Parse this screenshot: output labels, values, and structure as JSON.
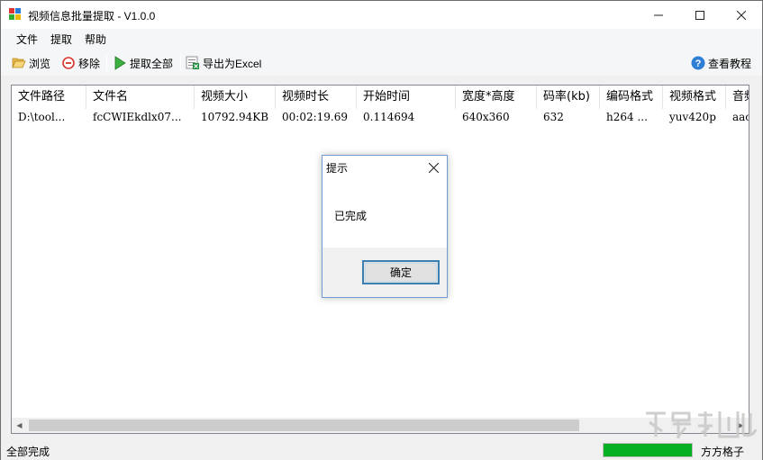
{
  "window": {
    "title": "视频信息批量提取 - V1.0.0"
  },
  "menu": [
    "文件",
    "提取",
    "帮助"
  ],
  "toolbar": {
    "browse": "浏览",
    "remove": "移除",
    "extract_all": "提取全部",
    "export_excel": "导出为Excel",
    "tutorial": "查看教程"
  },
  "table": {
    "columns": [
      "文件路径",
      "文件名",
      "视频大小",
      "视频时长",
      "开始时间",
      "宽度*高度",
      "码率(kb)",
      "编码格式",
      "视频格式",
      "音频"
    ],
    "rows": [
      [
        "D:\\tool...",
        "fcCWIEkdlx07...",
        "10792.94KB",
        "00:02:19.69",
        "0.114694",
        "640x360",
        "632",
        "h264 ...",
        "yuv420p",
        "aac"
      ]
    ]
  },
  "status": {
    "text": "全部完成",
    "progress_percent": 100,
    "author": "方方格子"
  },
  "dialog": {
    "title": "提示",
    "message": "已完成",
    "ok_label": "确定"
  },
  "colors": {
    "progress_fill": "#06b025",
    "dialog_border": "#6f9bd0",
    "ok_border": "#3c7fb1"
  }
}
